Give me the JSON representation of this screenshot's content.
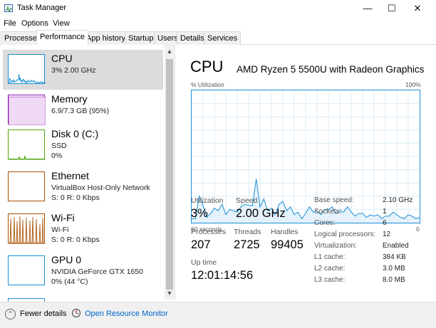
{
  "window": {
    "title": "Task Manager",
    "minimize_glyph": "—",
    "maximize_glyph": "☐",
    "close_glyph": "✕"
  },
  "menu": [
    "File",
    "Options",
    "View"
  ],
  "tabs": [
    "Processes",
    "Performance",
    "App history",
    "Startup",
    "Users",
    "Details",
    "Services"
  ],
  "active_tab": "Performance",
  "sidebar": {
    "items": [
      {
        "title": "CPU",
        "line1": "3% 2.00 GHz",
        "line2": "",
        "color": "#1a8fd6",
        "selected": true
      },
      {
        "title": "Memory",
        "line1": "6.9/7.3 GB (95%)",
        "line2": "",
        "color": "#8b12ae",
        "fill": 0.95
      },
      {
        "title": "Disk 0 (C:)",
        "line1": "SSD",
        "line2": "0%",
        "color": "#4da60c"
      },
      {
        "title": "Ethernet",
        "line1": "VirtualBox Host-Only Network",
        "line2": "S: 0 R: 0 Kbps",
        "color": "#a74f01"
      },
      {
        "title": "Wi-Fi",
        "line1": "Wi-Fi",
        "line2": "S: 0 R: 0 Kbps",
        "color": "#a74f01"
      },
      {
        "title": "GPU 0",
        "line1": "NVIDIA GeForce GTX 1650",
        "line2": "0% (44 °C)",
        "color": "#1a8fd6"
      }
    ],
    "scroll_up": "▲",
    "scroll_down": "▼"
  },
  "main": {
    "heading": "CPU",
    "model": "AMD Ryzen 5 5500U with Radeon Graphics",
    "graph": {
      "y_label": "% Utilization",
      "y_max_label": "100%",
      "x_label": "60 seconds",
      "x_min_label": "0",
      "color": "#1a8fd6",
      "values": [
        3,
        3,
        20,
        13,
        4,
        7,
        11,
        9,
        14,
        6,
        10,
        9,
        8,
        12,
        14,
        13,
        13,
        33,
        12,
        18,
        9,
        11,
        6,
        14,
        16,
        9,
        12,
        6,
        8,
        3,
        7,
        12,
        8,
        9,
        6,
        10,
        10,
        12,
        7,
        9,
        8,
        12,
        8,
        5,
        7,
        7,
        4,
        6,
        5,
        6,
        3,
        5,
        5,
        8,
        6,
        4,
        3,
        6,
        5,
        3,
        4
      ]
    },
    "stats": {
      "utilization_label": "Utilization",
      "utilization": "3%",
      "speed_label": "Speed",
      "speed": "2.00 GHz",
      "processes_label": "Processes",
      "processes": "207",
      "threads_label": "Threads",
      "threads": "2725",
      "handles_label": "Handles",
      "handles": "99405",
      "uptime_label": "Up time",
      "uptime": "12:01:14:56"
    },
    "specs": [
      {
        "key": "Base speed:",
        "value": "2.10 GHz"
      },
      {
        "key": "Sockets:",
        "value": "1"
      },
      {
        "key": "Cores:",
        "value": "6"
      },
      {
        "key": "Logical processors:",
        "value": "12"
      },
      {
        "key": "Virtualization:",
        "value": "Enabled"
      },
      {
        "key": "L1 cache:",
        "value": "384 KB"
      },
      {
        "key": "L2 cache:",
        "value": "3.0 MB"
      },
      {
        "key": "L3 cache:",
        "value": "8.0 MB"
      }
    ]
  },
  "footer": {
    "fewer_details": "Fewer details",
    "resource_monitor": "Open Resource Monitor"
  }
}
